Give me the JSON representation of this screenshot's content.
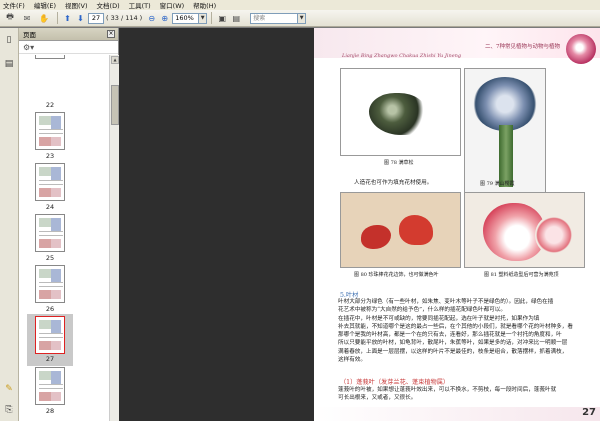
{
  "menubar": [
    "文件(F)",
    "编辑(E)",
    "视图(V)",
    "文档(D)",
    "工具(T)",
    "窗口(W)",
    "帮助(H)"
  ],
  "toolbar": {
    "current_page": "27",
    "page_count": "( 33 / 114 )",
    "zoom": "160%",
    "search_placeholder": "搜索"
  },
  "panel": {
    "title": "页面",
    "close": "×"
  },
  "thumbnails": [
    {
      "label": "22",
      "selected": false
    },
    {
      "label": "23",
      "selected": false
    },
    {
      "label": "24",
      "selected": false
    },
    {
      "label": "25",
      "selected": false
    },
    {
      "label": "26",
      "selected": false
    },
    {
      "label": "27",
      "selected": true
    },
    {
      "label": "28",
      "selected": false
    }
  ],
  "page": {
    "header_title": "二、7种常见植物与动物与植物",
    "header_pinyin": "Lianjie Bing Zhangwo Chakua Zhishi Yu Jineng",
    "captions": {
      "fig78": "图 78  满草松",
      "fig79": "图 79  满山樱霞",
      "fig80": "图 80  珍珠棒花花边饰，也可做满色叶",
      "fig81": "图 81  塑料纸造型后可营为满苑顶"
    },
    "caption_line": "人造花也可作为填充花材使用。",
    "section_heading": "5.叶材",
    "paragraph": [
      "叶材大部分为绿色（有一些叶材，如朱焦、变叶木等叶子不是绿色的）。因此，绿色在插",
      "花艺术中被称为“大自然的给予色”，什么样的插花配绿色叶都可以。",
      "在插花中，叶材是不可或缺的，常要同插花配起，选在叶子就是衬托，如果作为填",
      "补去其就能，不知道哪个是这的最占一些后，在个其他的小段们，就是看哪个花的叶材种多，看",
      "那哪个是我的叶材高，都是一个在的只有去，连看好，那么插花就是一个衬托的角度和，叶",
      "所以只要能平放的叶材，如龟背叶，散尾叶，朱蕉等叶，如果是多的话，对冲来比一明顺一层",
      "满着春放，上面是一层层摆，以这样的叶片不是最佳的，枝条是组合，散落摆样，抓着满枝，",
      "这样有效。"
    ],
    "sub_heading": "（1）蓬莪叶（发芽兰花、蓬束植物属）",
    "paragraph2": [
      "蓬莪叶的叶被，如果想让蓬莪叶效出来，可以不换水，不剪枝，每一段时间后，蓬莪叶就",
      "可长出根来，又或者，又很长。"
    ],
    "page_number": "27"
  }
}
